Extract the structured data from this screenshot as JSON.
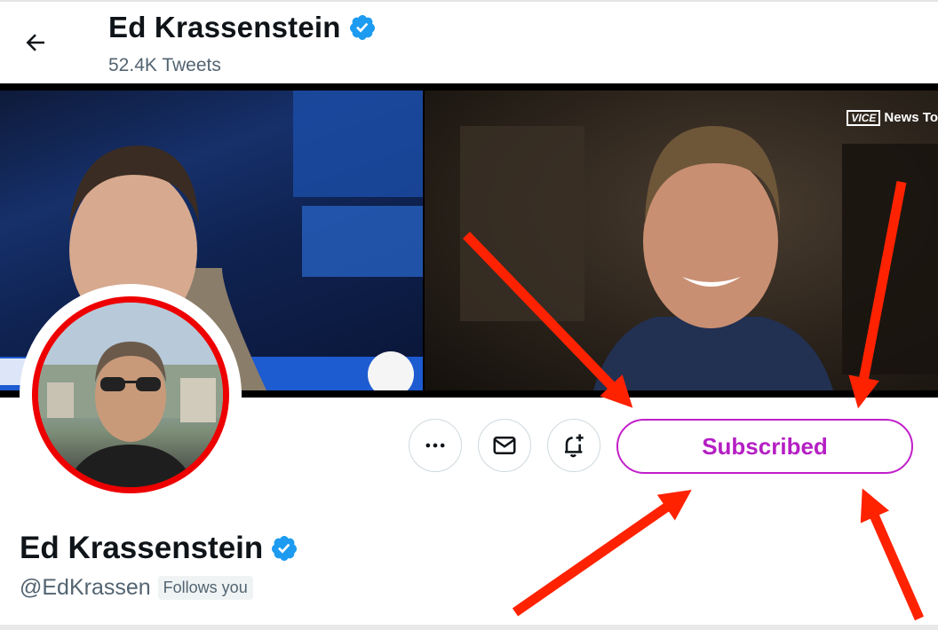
{
  "header": {
    "name": "Ed Krassenstein",
    "tweet_count": "52.4K Tweets",
    "back_icon": "arrow-left-icon",
    "verified_icon": "verified-badge-icon"
  },
  "banner": {
    "right_overlay_text": "News To",
    "right_overlay_logo": "VICE"
  },
  "actions": {
    "more_icon": "more-horizontal-icon",
    "message_icon": "mail-icon",
    "notify_icon": "bell-plus-icon",
    "subscribe_label": "Subscribed"
  },
  "profile": {
    "name": "Ed Krassenstein",
    "handle": "@EdKrassen",
    "follows_you": "Follows you"
  },
  "colors": {
    "accent_subscribed": "#b51fc4",
    "verified_blue": "#1d9bf0",
    "annotation_red": "#ff2200",
    "avatar_ring": "#e00000"
  }
}
